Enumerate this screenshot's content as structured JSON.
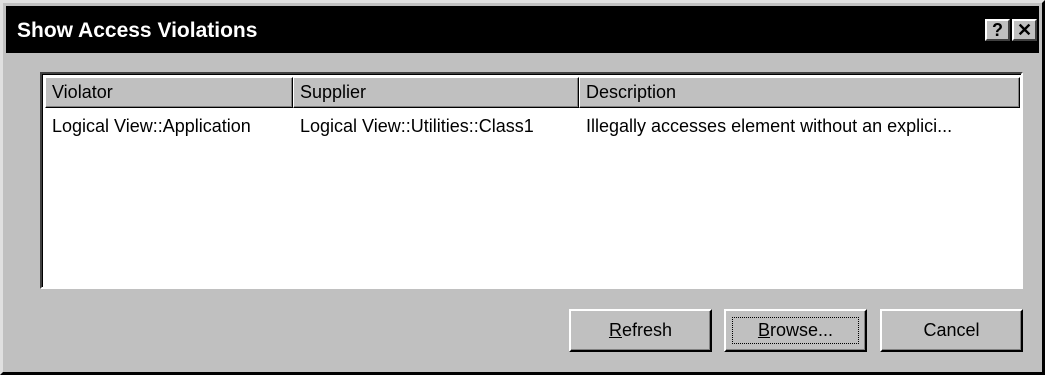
{
  "window": {
    "title": "Show Access Violations",
    "help_glyph": "?",
    "close_glyph": "✕"
  },
  "list": {
    "columns": [
      "Violator",
      "Supplier",
      "Description"
    ],
    "rows": [
      {
        "violator": "Logical View::Application",
        "supplier": "Logical View::Utilities::Class1",
        "description": "Illegally accesses element without an explici..."
      }
    ]
  },
  "buttons": {
    "refresh": {
      "label": "Refresh",
      "mnemonic_index": 0
    },
    "browse": {
      "label": "Browse...",
      "mnemonic_index": 0
    },
    "cancel": {
      "label": "Cancel"
    }
  },
  "icons": {
    "help": "help-icon",
    "close": "close-icon"
  }
}
